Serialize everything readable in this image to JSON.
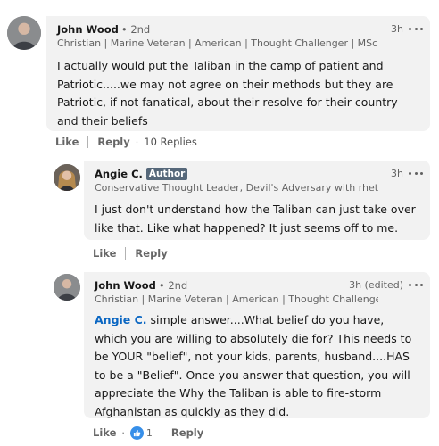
{
  "comments": [
    {
      "name": "John Wood",
      "degree": "• 2nd",
      "time": "3h",
      "headline": "Christian | Marine Veteran | American | Thought Challenger | MSc./BS...",
      "text": "I actually would put the Taliban in the camp of patient and Patriotic.....we may not agree on their methods but they are Patriotic, if not fanatical, about their resolve for their country and their beliefs",
      "actions": {
        "like": "Like",
        "reply": "Reply",
        "dot": "·",
        "replies": "10 Replies"
      }
    },
    {
      "name": "Angie C.",
      "badge": "Author",
      "time": "3h",
      "headline": "Conservative Thought Leader, Devil's Adversary with rhetoric...",
      "text": "I just don't understand how the Taliban can just take over like that. Like what happened? It just seems off to me.",
      "actions": {
        "like": "Like",
        "reply": "Reply"
      }
    },
    {
      "name": "John Wood",
      "degree": "• 2nd",
      "time": "3h (edited)",
      "headline": "Christian | Marine Veteran | American | Thought Challenger | ...",
      "mention": "Angie C.",
      "text": " simple answer....What belief do you have, which you are willing to absolutely die for? This needs to be YOUR \"belief\", not your kids, parents, husband....HAS to be a \"Belief\". Once you answer that question, you will appreciate the Why the Taliban is able to fire-storm Afghanistan as quickly as they did.",
      "actions": {
        "like": "Like",
        "dot": "·",
        "reaction_count": "1",
        "reply": "Reply"
      }
    }
  ],
  "icons": {
    "more": "more-horizontal-icon",
    "like": "like-reaction-icon"
  },
  "colors": {
    "bubble": "#f2f2f2",
    "mention": "#0a66c2",
    "author_badge": "#56687a",
    "like_reaction": "#378fe9"
  }
}
